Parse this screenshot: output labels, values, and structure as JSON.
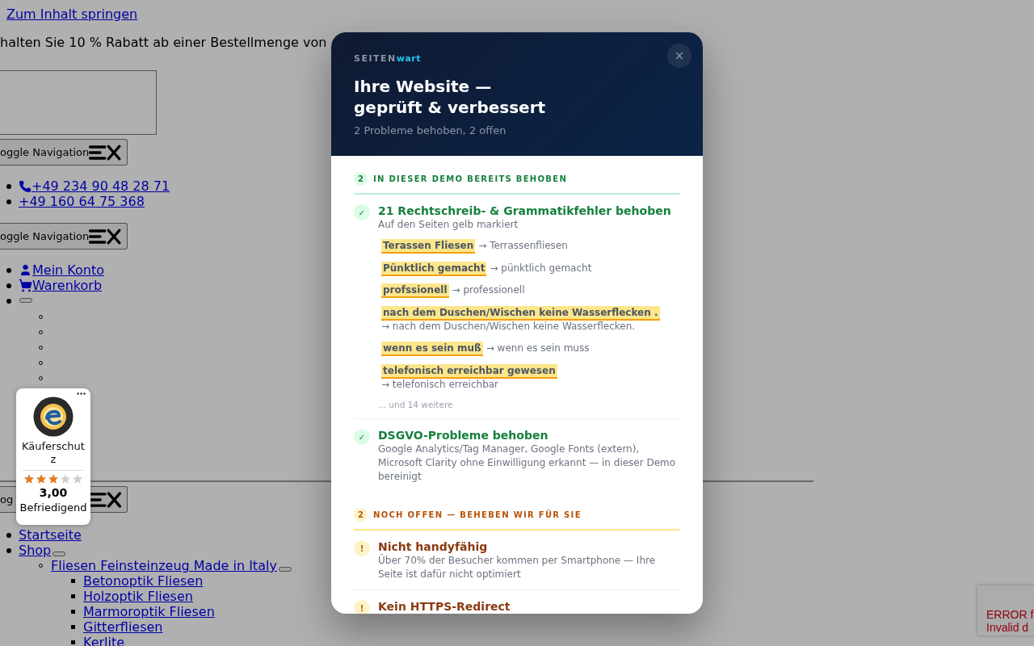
{
  "page": {
    "skip_link": "Zum Inhalt springen",
    "promo": "halten Sie 10 % Rabatt ab einer Bestellmenge von",
    "toggle_1": {
      "label": "oggle Navigation"
    },
    "phones": [
      {
        "label": "+49 234 90 48 28 71",
        "kind": "phone"
      },
      {
        "label": "+49 160 64 75 368",
        "kind": "plain"
      }
    ],
    "toggle_2": {
      "label": "oggle Navigation"
    },
    "account_menu": [
      {
        "kind": "account",
        "label": "Mein Konto"
      },
      {
        "kind": "cart",
        "label": "Warenkorb"
      },
      {
        "kind": "submenu",
        "children": [
          {
            "kind": "empty"
          },
          {
            "kind": "empty"
          },
          {
            "kind": "empty"
          },
          {
            "kind": "empty"
          },
          {
            "kind": "empty"
          }
        ]
      }
    ],
    "toggle_3": {
      "label": "og"
    },
    "main_menu": [
      {
        "label": "Startseite",
        "submenu_button": false
      },
      {
        "label": "Shop",
        "submenu_button": true,
        "children": [
          {
            "label": "Fliesen Feinsteinzeug Made in Italy",
            "submenu_button": true,
            "children": [
              {
                "label": "Betonoptik Fliesen",
                "submenu_button": false
              },
              {
                "label": "Holzoptik Fliesen",
                "submenu_button": false
              },
              {
                "label": "Marmoroptik Fliesen",
                "submenu_button": false
              },
              {
                "label": "Gitterfliesen",
                "submenu_button": false
              },
              {
                "label": "Kerlite",
                "submenu_button": false
              }
            ]
          }
        ]
      }
    ]
  },
  "badge": {
    "title": "Käuferschutz",
    "stars": 3,
    "score": "3,00",
    "rating": "Befriedigend"
  },
  "recaptcha": {
    "lines": [
      "ERROR f",
      "Invalid d"
    ]
  },
  "modal": {
    "brand": {
      "strong": "SEITEN",
      "accent": "wart"
    },
    "title": [
      "Ihre Website —",
      "geprüft & verbessert"
    ],
    "subtitle": "2 Probleme behoben, 2 offen",
    "close": "×",
    "sections": [
      {
        "kind": "fixed",
        "count": "2",
        "label": "IN DIESER DEMO BEREITS BEHOBEN",
        "items": [
          {
            "icon": "✓",
            "title": "21 Rechtschreib- & Grammatikfehler behoben",
            "description": "Auf den Seiten gelb markiert",
            "corrections": [
              {
                "wrong": "Terassen Fliesen",
                "fixed": "→ Terrassenfliesen"
              },
              {
                "wrong": "Pünktlich gemacht",
                "fixed": "→ pünktlich gemacht"
              },
              {
                "wrong": "profssionell",
                "fixed": "→ professionell"
              },
              {
                "wrong": "nach dem Duschen/Wischen keine Wasserflecken .",
                "fixed": "→ nach dem Duschen/Wischen keine Wasserflecken."
              },
              {
                "wrong": "wenn es sein muß",
                "fixed": "→ wenn es sein muss"
              },
              {
                "wrong": "telefonisch erreichbar gewesen",
                "fixed": "→ telefonisch erreichbar"
              }
            ],
            "more": "... und 14 weitere"
          },
          {
            "icon": "✓",
            "title": "DSGVO-Probleme behoben",
            "description": "Google Analytics/Tag Manager, Google Fonts (extern), Microsoft Clarity ohne Einwilligung erkannt — in dieser Demo bereinigt"
          }
        ]
      },
      {
        "kind": "open",
        "count": "2",
        "label": "NOCH OFFEN — BEHEBEN WIR FÜR SIE",
        "items": [
          {
            "icon": "!",
            "title": "Nicht handyfähig",
            "description": "Über 70% der Besucher kommen per Smartphone — Ihre Seite ist dafür nicht optimiert"
          },
          {
            "icon": "!",
            "title": "Kein HTTPS-Redirect"
          }
        ]
      }
    ]
  }
}
